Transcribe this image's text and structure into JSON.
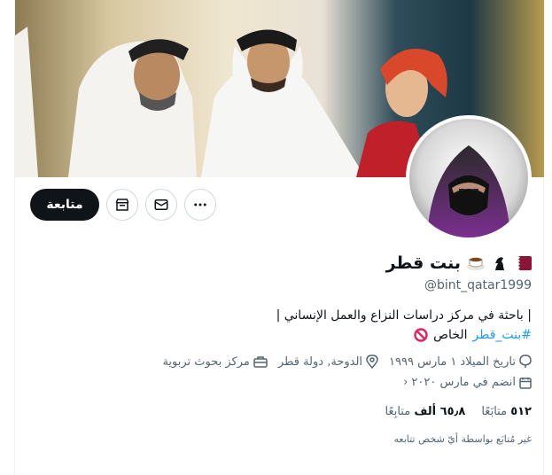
{
  "profile": {
    "name": "بنت قطر",
    "handle": "@bint_qatar1999",
    "bio_line1": "| باحثة في مركز دراسات النزاع والعمل الإنساني |",
    "bio_hashtag": "#بنت_قطر",
    "bio_private": "الخاص",
    "birth": "تاريخ الميلاد ١ مارس ١٩٩٩",
    "location": "الدوحة, دولة قطر",
    "category": "مركز بحوث تربوية",
    "joined": "انضم في مارس ٢٠٢٠",
    "following_count": "٥١٢",
    "following_label": "متابَعًا",
    "followers_count": "٦٥٫٨ ألف",
    "followers_label": "متابِعًا",
    "not_followed_note": "غير مُتابَع بواسطة أيّ شخص تتابعه"
  },
  "actions": {
    "follow_label": "متابعة"
  },
  "icons": {
    "flag": "qatar-flag-icon",
    "chess": "chess-knight-icon",
    "coffee": "coffee-cup-icon",
    "prohibited": "prohibited-icon",
    "calendar": "calendar-icon",
    "pin": "location-pin-icon",
    "bag": "briefcase-icon",
    "balloon": "balloon-icon",
    "more": "more-icon",
    "message": "envelope-icon",
    "shop": "shop-icon"
  },
  "colors": {
    "accent": "#1d9bf0",
    "follow_bg": "#0f1419",
    "qatar_maroon": "#8a1538",
    "muted": "#536471"
  }
}
